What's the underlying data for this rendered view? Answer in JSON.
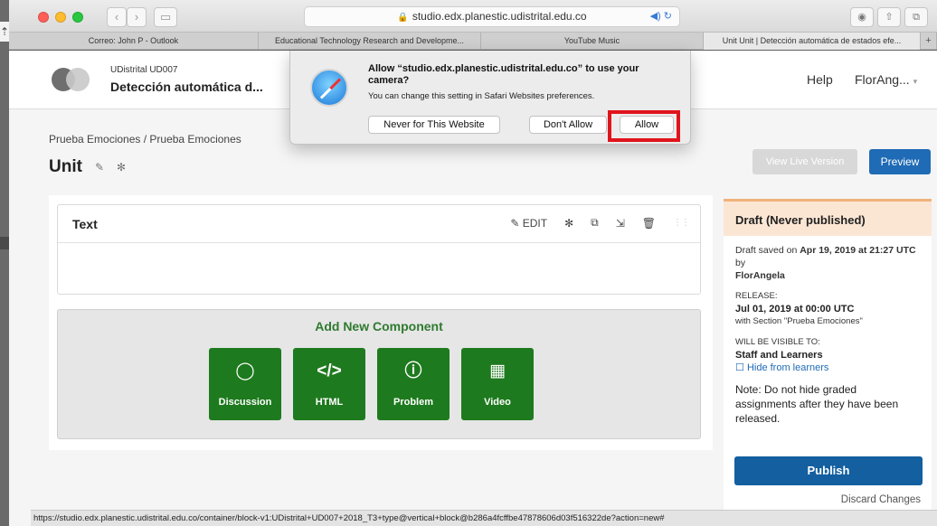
{
  "browser": {
    "url": "studio.edx.planestic.udistrital.edu.co",
    "tabs": [
      {
        "label": "Correo: John P - Outlook",
        "active": false
      },
      {
        "label": "Educational Technology Research and Developme...",
        "active": false
      },
      {
        "label": "YouTube Music",
        "active": false
      },
      {
        "label": "Unit Unit | Detección automática de estados efe...",
        "active": true
      }
    ],
    "new_tab": "+"
  },
  "header": {
    "org": "UDistrital UD007",
    "course": "Detección automática d...",
    "help": "Help",
    "user": "FlorAng..."
  },
  "breadcrumb": "Prueba Emociones / Prueba Emociones",
  "unit": {
    "title": "Unit"
  },
  "actions": {
    "view_live": "View Live Version",
    "preview": "Preview"
  },
  "xblock": {
    "title": "Text",
    "edit": "EDIT"
  },
  "add_component": {
    "title": "Add New Component",
    "buttons": [
      {
        "label": "Discussion",
        "icon": "comment-icon",
        "glyph": "◌"
      },
      {
        "label": "HTML",
        "icon": "code-icon",
        "glyph": "</>"
      },
      {
        "label": "Problem",
        "icon": "question-icon",
        "glyph": "?"
      },
      {
        "label": "Video",
        "icon": "film-icon",
        "glyph": "▦"
      }
    ]
  },
  "sidebar": {
    "title": "Draft (Never published)",
    "saved_prefix": "Draft saved on ",
    "saved_date": "Apr 19, 2019 at 21:27 UTC",
    "saved_by": " by",
    "saved_user": "FlorAngela",
    "release_label": "RELEASE:",
    "release_date": "Jul 01, 2019 at 00:00 UTC",
    "release_section": "with Section \"Prueba Emociones\"",
    "visible_label": "WILL BE VISIBLE TO:",
    "visible_value": "Staff and Learners",
    "hide_link": "Hide from learners",
    "note": "Note: Do not hide graded assignments after they have been released.",
    "publish": "Publish",
    "discard": "Discard Changes"
  },
  "dialog": {
    "title": "Allow “studio.edx.planestic.udistrital.edu.co” to use your camera?",
    "subtitle": "You can change this setting in Safari Websites preferences.",
    "never": "Never for This Website",
    "dont_allow": "Don't Allow",
    "allow": "Allow"
  },
  "status_url": "https://studio.edx.planestic.udistrital.edu.co/container/block-v1:UDistrital+UD007+2018_T3+type@vertical+block@b286a4fcffbe47878606d03f516322de?action=new#",
  "colors": {
    "green": "#1e7a1e",
    "blue": "#1f6bb5",
    "publish": "#135f9f",
    "highlight": "#e0141c"
  }
}
